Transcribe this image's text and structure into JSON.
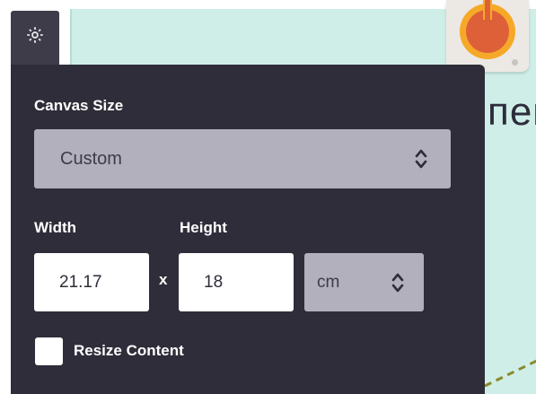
{
  "toolbar": {
    "settings_icon": "gear-icon"
  },
  "background": {
    "partial_text": "пек",
    "sticker_icon": "thermometer-icon"
  },
  "panel": {
    "canvas_size_label": "Canvas Size",
    "canvas_size_value": "Custom",
    "width_label": "Width",
    "height_label": "Height",
    "width_value": "21.17",
    "times_symbol": "x",
    "height_value": "18",
    "unit_value": "cm",
    "resize_content_label": "Resize Content",
    "resize_content_checked": false
  },
  "colors": {
    "panel_bg": "#2f2d39",
    "select_bg": "#b2b0bd",
    "canvas_bg": "#cfeee8",
    "accent_orange": "#f6a928",
    "accent_red": "#de6039"
  }
}
